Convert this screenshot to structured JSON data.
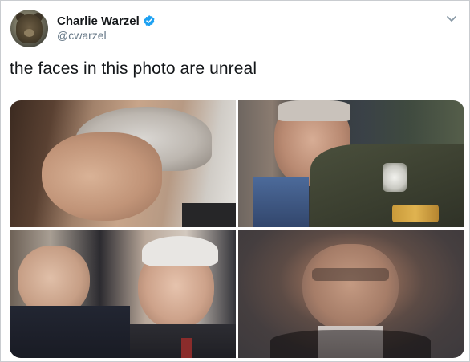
{
  "user": {
    "display_name": "Charlie Warzel",
    "handle": "@cwarzel",
    "verified_color": "#1da1f2",
    "avatar_icon": "bear-avatar"
  },
  "tweet": {
    "text": "the faces in this photo are unreal"
  },
  "media": {
    "photo_count": 4
  },
  "icons": {
    "verified": "verified-badge-icon",
    "more": "chevron-down-icon"
  }
}
